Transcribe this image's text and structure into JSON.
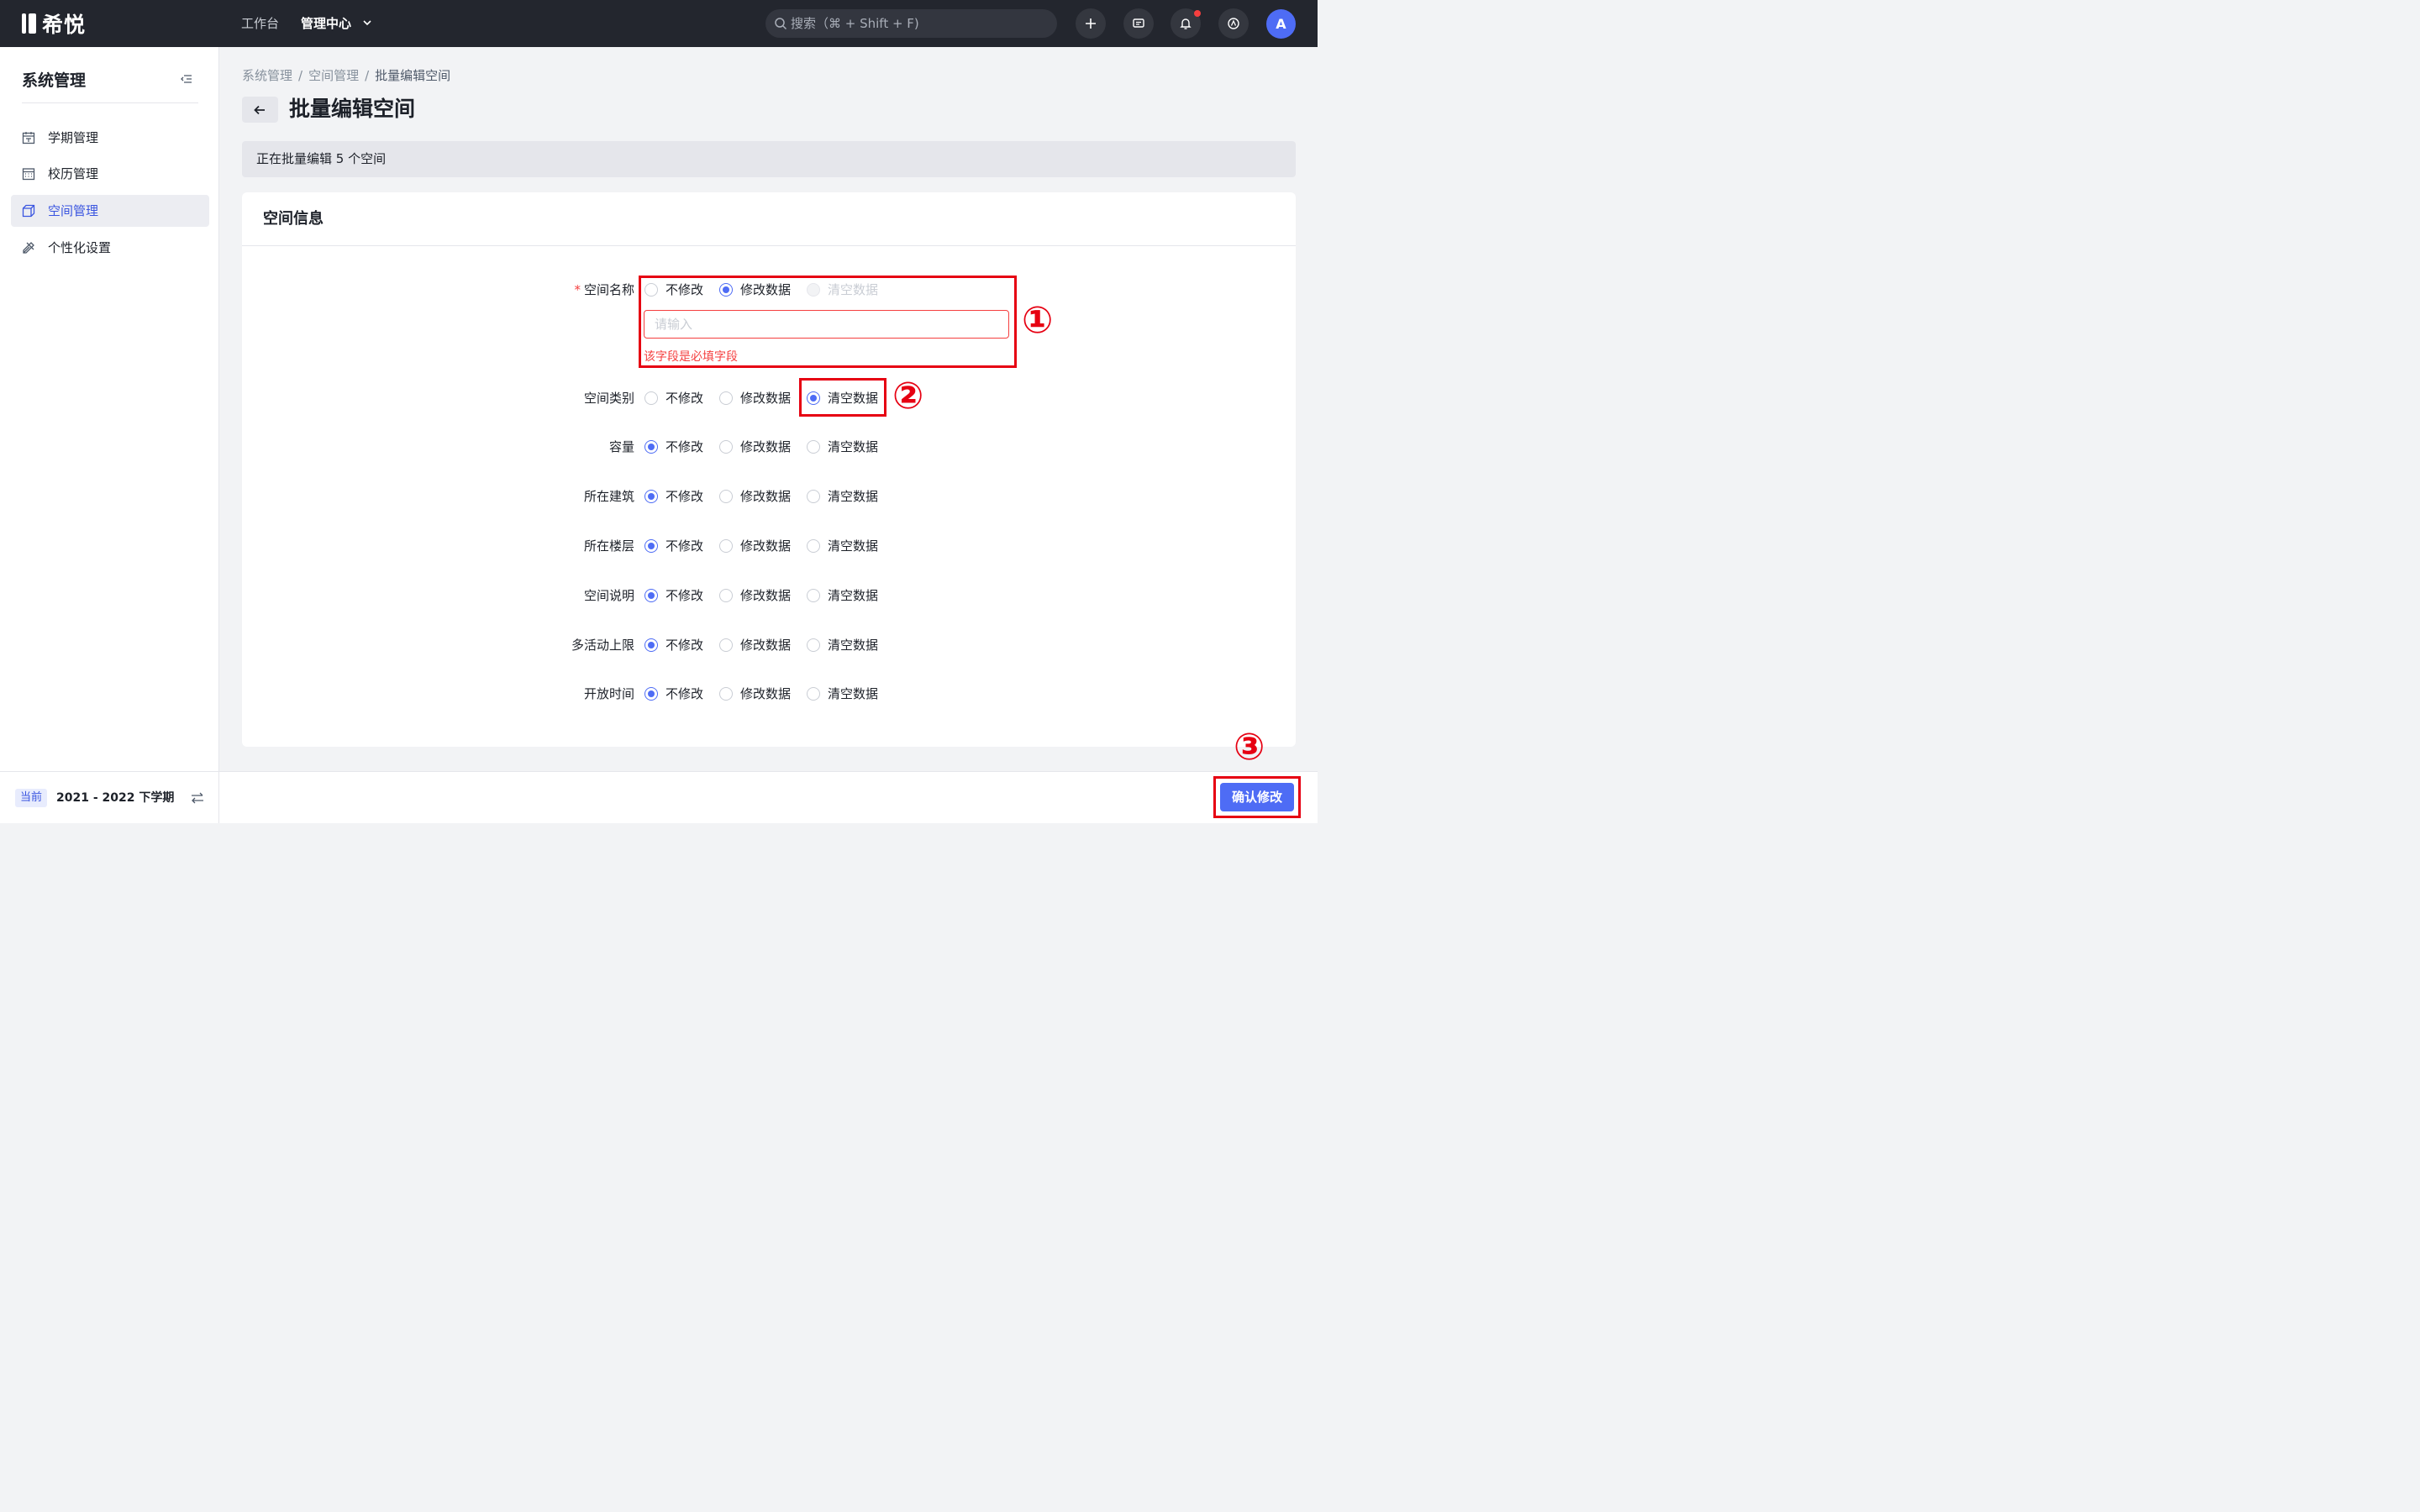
{
  "app": {
    "logo_text": "希悦"
  },
  "topbar": {
    "nav": [
      "工作台",
      "管理中心"
    ],
    "search_placeholder": "搜索（⌘ + Shift + F)",
    "avatar_initial": "A"
  },
  "sidebar": {
    "title": "系统管理",
    "items": [
      {
        "label": "学期管理",
        "icon": "calendar-icon",
        "active": false
      },
      {
        "label": "校历管理",
        "icon": "grid-calendar-icon",
        "active": false
      },
      {
        "label": "空间管理",
        "icon": "cube-icon",
        "active": true
      },
      {
        "label": "个性化设置",
        "icon": "tools-icon",
        "active": false
      }
    ],
    "term_tag": "当前",
    "term_text": "2021 - 2022 下学期"
  },
  "breadcrumb": [
    "系统管理",
    "空间管理",
    "批量编辑空间"
  ],
  "page_title": "批量编辑空间",
  "banner_text": "正在批量编辑 5 个空间",
  "card": {
    "title": "空间信息",
    "options": [
      "不修改",
      "修改数据",
      "清空数据"
    ],
    "fields": [
      {
        "label": "空间名称",
        "required": true,
        "selected": 1,
        "disabled": [
          2
        ]
      },
      {
        "label": "空间类别",
        "required": false,
        "selected": 2,
        "disabled": []
      },
      {
        "label": "容量",
        "required": false,
        "selected": 0,
        "disabled": []
      },
      {
        "label": "所在建筑",
        "required": false,
        "selected": 0,
        "disabled": []
      },
      {
        "label": "所在楼层",
        "required": false,
        "selected": 0,
        "disabled": []
      },
      {
        "label": "空间说明",
        "required": false,
        "selected": 0,
        "disabled": []
      },
      {
        "label": "多活动上限",
        "required": false,
        "selected": 0,
        "disabled": []
      },
      {
        "label": "开放时间",
        "required": false,
        "selected": 0,
        "disabled": []
      }
    ],
    "name_input_placeholder": "请输入",
    "name_error": "该字段是必填字段"
  },
  "annotations": [
    "①",
    "②",
    "③"
  ],
  "confirm_label": "确认修改",
  "colors": {
    "primary": "#4e6cf5",
    "error": "#f53f3f",
    "annotation": "#e60012",
    "topbar": "#23262e"
  }
}
